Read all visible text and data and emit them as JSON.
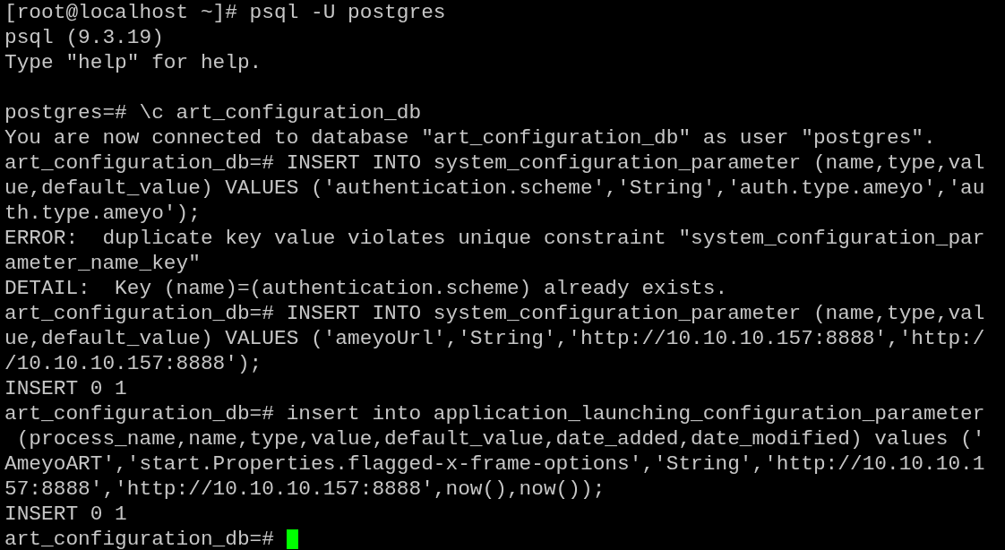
{
  "terminal": {
    "lines": [
      {
        "kind": "text",
        "text": "[root@localhost ~]# psql -U postgres"
      },
      {
        "kind": "text",
        "text": "psql (9.3.19)"
      },
      {
        "kind": "text",
        "text": "Type \"help\" for help."
      },
      {
        "kind": "blank"
      },
      {
        "kind": "text",
        "text": "postgres=# \\c art_configuration_db"
      },
      {
        "kind": "text",
        "text": "You are now connected to database \"art_configuration_db\" as user \"postgres\"."
      },
      {
        "kind": "text",
        "text": "art_configuration_db=# INSERT INTO system_configuration_parameter (name,type,val"
      },
      {
        "kind": "text",
        "text": "ue,default_value) VALUES ('authentication.scheme','String','auth.type.ameyo','au"
      },
      {
        "kind": "text",
        "text": "th.type.ameyo');"
      },
      {
        "kind": "text",
        "text": "ERROR:  duplicate key value violates unique constraint \"system_configuration_par"
      },
      {
        "kind": "text",
        "text": "ameter_name_key\""
      },
      {
        "kind": "text",
        "text": "DETAIL:  Key (name)=(authentication.scheme) already exists."
      },
      {
        "kind": "text",
        "text": "art_configuration_db=# INSERT INTO system_configuration_parameter (name,type,val"
      },
      {
        "kind": "text",
        "text": "ue,default_value) VALUES ('ameyoUrl','String','http://10.10.10.157:8888','http:/"
      },
      {
        "kind": "text",
        "text": "/10.10.10.157:8888');"
      },
      {
        "kind": "text",
        "text": "INSERT 0 1"
      },
      {
        "kind": "text",
        "text": "art_configuration_db=# insert into application_launching_configuration_parameter"
      },
      {
        "kind": "text",
        "text": " (process_name,name,type,value,default_value,date_added,date_modified) values ('"
      },
      {
        "kind": "text",
        "text": "AmeyoART','start.Properties.flagged-x-frame-options','String','http://10.10.10.1"
      },
      {
        "kind": "text",
        "text": "57:8888','http://10.10.10.157:8888',now(),now());"
      },
      {
        "kind": "text",
        "text": "INSERT 0 1"
      },
      {
        "kind": "prompt",
        "text": "art_configuration_db=# ",
        "cursor": true
      }
    ]
  }
}
